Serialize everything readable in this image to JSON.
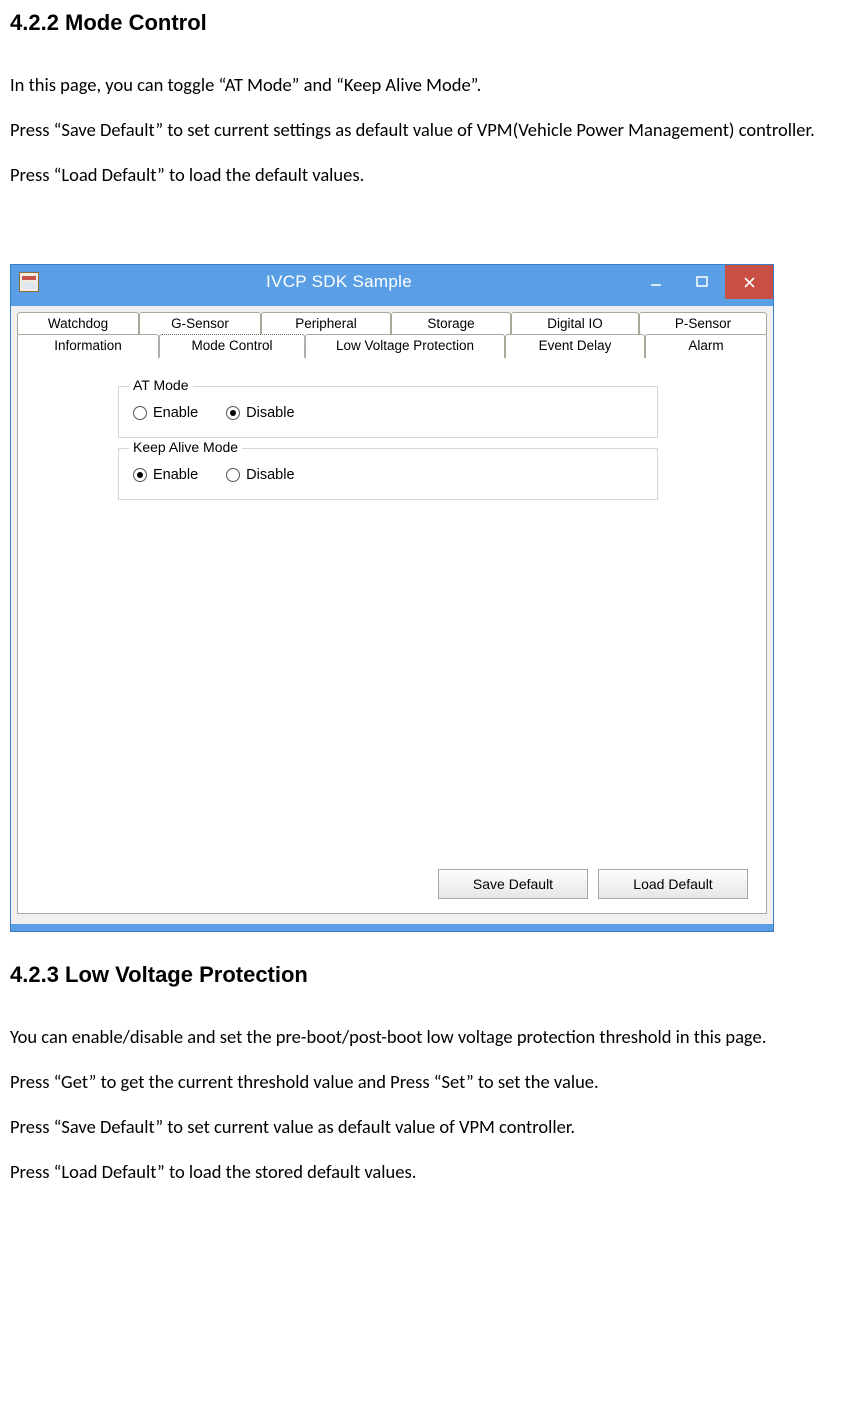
{
  "sec1": {
    "heading": "4.2.2 Mode Control",
    "p1": "In this page, you can toggle “AT Mode” and “Keep Alive Mode”.",
    "p2": "Press “Save Default” to set current settings as default value of VPM(Vehicle Power Management) controller.",
    "p3": "Press “Load Default” to load the default values."
  },
  "windowTitle": "IVCP SDK Sample",
  "tabsRow1": {
    "watchdog": "Watchdog",
    "gsensor": "G-Sensor",
    "peripheral": "Peripheral",
    "storage": "Storage",
    "digitalio": "Digital IO",
    "psensor": "P-Sensor"
  },
  "tabsRow2": {
    "information": "Information",
    "modecontrol": "Mode Control",
    "lvp": "Low Voltage Protection",
    "eventdelay": "Event Delay",
    "alarm": "Alarm"
  },
  "groupAT": {
    "legend": "AT Mode",
    "enable": "Enable",
    "disable": "Disable",
    "selected": "disable"
  },
  "groupKA": {
    "legend": "Keep Alive Mode",
    "enable": "Enable",
    "disable": "Disable",
    "selected": "enable"
  },
  "btnSaveDefault": "Save Default",
  "btnLoadDefault": "Load Default",
  "sec2": {
    "heading": "4.2.3 Low Voltage Protection",
    "p1": "You can enable/disable and set the pre-boot/post-boot low voltage protection threshold in this page.",
    "p2": "Press “Get” to get the current threshold value and Press “Set” to set the value.",
    "p3": "Press “Save Default” to set current value as default value of VPM controller.",
    "p4": "Press “Load Default” to load the stored default values."
  }
}
